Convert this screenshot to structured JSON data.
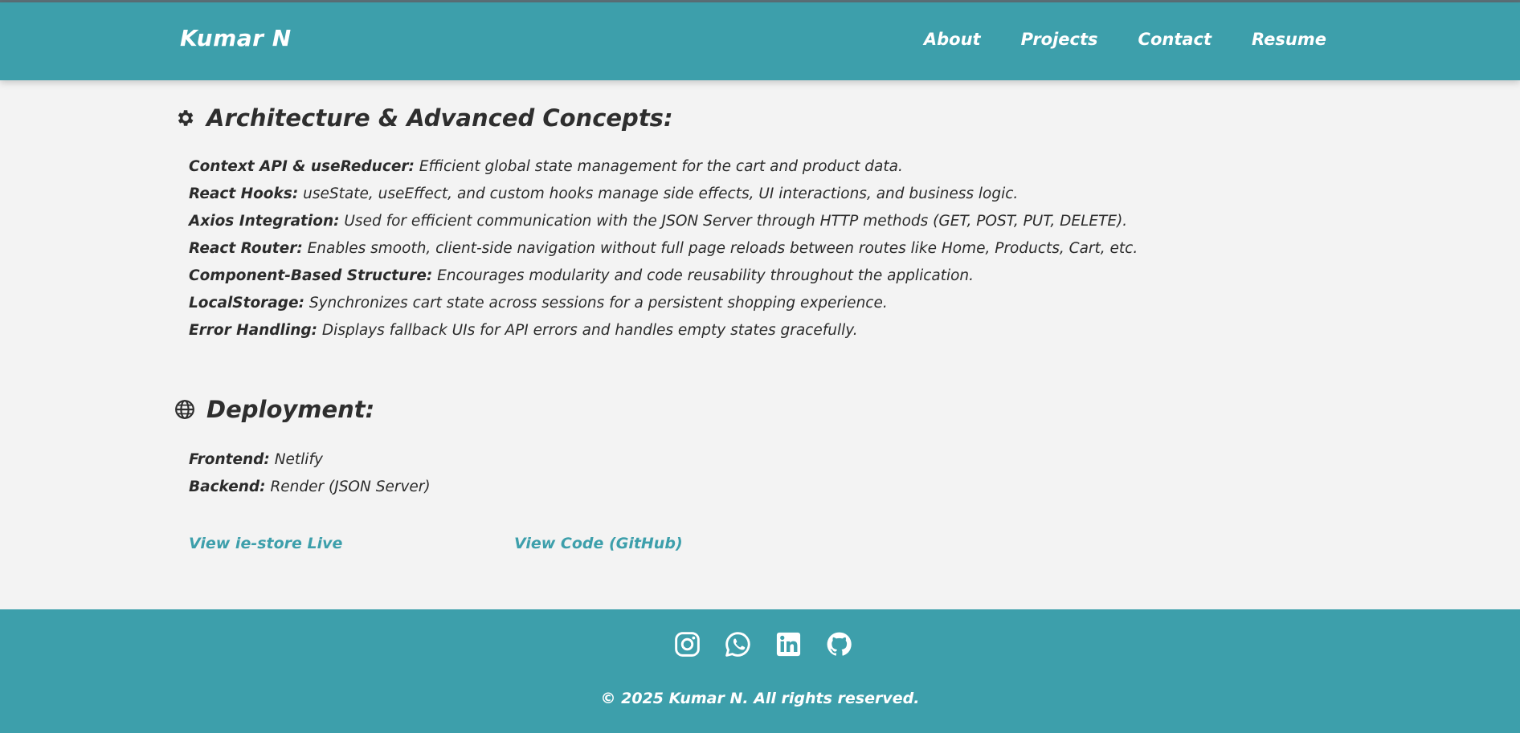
{
  "header": {
    "brand": "Kumar N",
    "nav": [
      {
        "label": "About"
      },
      {
        "label": "Projects"
      },
      {
        "label": "Contact"
      },
      {
        "label": "Resume"
      }
    ]
  },
  "architecture": {
    "icon": "gear-icon",
    "title": "Architecture & Advanced Concepts:",
    "items": [
      {
        "term": "Context API & useReducer:",
        "text": " Efficient global state management for the cart and product data."
      },
      {
        "term": "React Hooks:",
        "text": " useState, useEffect, and custom hooks manage side effects, UI interactions, and business logic."
      },
      {
        "term": "Axios Integration:",
        "text": " Used for efficient communication with the JSON Server through HTTP methods (GET, POST, PUT, DELETE)."
      },
      {
        "term": "React Router:",
        "text": " Enables smooth, client-side navigation without full page reloads between routes like Home, Products, Cart, etc."
      },
      {
        "term": "Component-Based Structure:",
        "text": " Encourages modularity and code reusability throughout the application."
      },
      {
        "term": "LocalStorage:",
        "text": " Synchronizes cart state across sessions for a persistent shopping experience."
      },
      {
        "term": "Error Handling:",
        "text": " Displays fallback UIs for API errors and handles empty states gracefully."
      }
    ]
  },
  "deployment": {
    "icon": "globe-icon",
    "title": "Deployment:",
    "items": [
      {
        "term": "Frontend:",
        "text": " Netlify"
      },
      {
        "term": "Backend:",
        "text": " Render (JSON Server)"
      }
    ]
  },
  "links": {
    "live": "View ie-store Live",
    "code": "View Code (GitHub)"
  },
  "footer": {
    "socials": [
      "instagram-icon",
      "whatsapp-icon",
      "linkedin-icon",
      "github-icon"
    ],
    "copyright": "© 2025 Kumar N. All rights reserved."
  },
  "colors": {
    "accent": "#3d9fab",
    "background": "#f3f3f3",
    "text": "#2b2b2b"
  }
}
